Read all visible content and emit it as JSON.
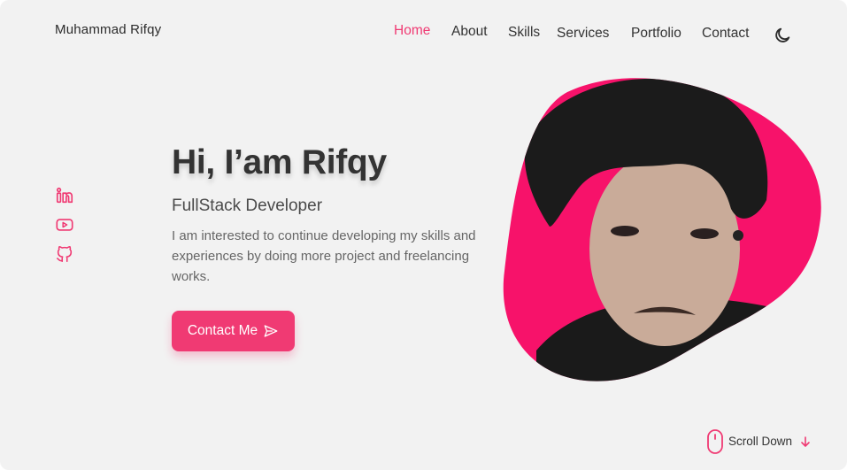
{
  "brand": "Muhammad Rifqy",
  "nav": {
    "items": [
      {
        "label": "Home",
        "active": true
      },
      {
        "label": "About"
      },
      {
        "label": "Skills"
      },
      {
        "label": "Services"
      },
      {
        "label": "Portfolio"
      },
      {
        "label": "Contact"
      }
    ],
    "theme_toggle_icon": "moon-icon"
  },
  "social": [
    {
      "icon": "linkedin-icon"
    },
    {
      "icon": "youtube-icon"
    },
    {
      "icon": "github-icon"
    }
  ],
  "hero": {
    "title": "Hi, I’am Rifqy",
    "subtitle": "FullStack Developer",
    "description": "I am interested to continue developing my skills and experiences by doing more project and freelancing works.",
    "cta_label": "Contact Me",
    "cta_icon": "send-icon"
  },
  "scroll": {
    "label": "Scroll Down",
    "icon": "mouse-icon",
    "arrow_icon": "arrow-down-icon"
  },
  "colors": {
    "accent": "#f03a73",
    "background": "#f2f2f2",
    "text": "#333333"
  }
}
